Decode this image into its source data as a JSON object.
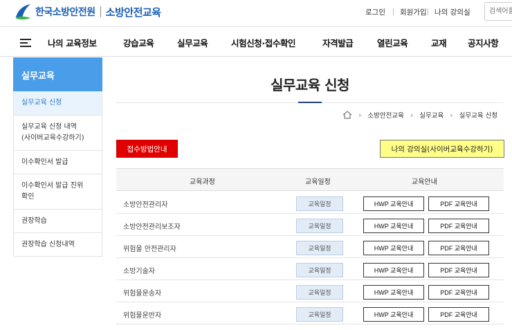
{
  "header": {
    "org_name": "한국소방안전원",
    "site_name": "소방안전교육",
    "links": [
      "로그인",
      "회원가입",
      "나의 강의실"
    ],
    "search_placeholder": "검색어를"
  },
  "nav": {
    "items": [
      "나의 교육정보",
      "강습교육",
      "실무교육",
      "시험신청·접수확인",
      "자격발급",
      "열린교육",
      "교재",
      "공지사항"
    ]
  },
  "sidebar": {
    "title": "실무교육",
    "items": [
      {
        "label": "실무교육 신청",
        "active": true
      },
      {
        "label": "실무교육 신청 내역\n(사이버교육수강하기)",
        "active": false
      },
      {
        "label": "이수확인서 발급",
        "active": false
      },
      {
        "label": "이수확인서 발급 진위\n확인",
        "active": false
      },
      {
        "label": "권장학습",
        "active": false
      },
      {
        "label": "권장학습 신청내역",
        "active": false
      }
    ]
  },
  "main": {
    "title": "실무교육 신청",
    "breadcrumb": [
      "소방안전교육",
      "실무교육",
      "실무교육 신청"
    ],
    "register_button": "접수방법안내",
    "classroom_button": "나의 강의실(사이버교육수강하기)",
    "table": {
      "headers": [
        "교육과정",
        "교육일정",
        "교육안내"
      ],
      "rows": [
        {
          "name": "소방안전관리자",
          "schedule": "교육일정",
          "hwp": "HWP 교육안내",
          "pdf": "PDF 교육안내"
        },
        {
          "name": "소방안전관리보조자",
          "schedule": "교육일정",
          "hwp": "HWP 교육안내",
          "pdf": "PDF 교육안내"
        },
        {
          "name": "위험물 안전관리자",
          "schedule": "교육일정",
          "hwp": "HWP 교육안내",
          "pdf": "PDF 교육안내"
        },
        {
          "name": "소방기술자",
          "schedule": "교육일정",
          "hwp": "HWP 교육안내",
          "pdf": "PDF 교육안내"
        },
        {
          "name": "위험물운송자",
          "schedule": "교육일정",
          "hwp": "HWP 교육안내",
          "pdf": "PDF 교육안내"
        },
        {
          "name": "위험물운반자",
          "schedule": "교육일정",
          "hwp": "HWP 교육안내",
          "pdf": "PDF 교육안내"
        }
      ]
    }
  },
  "colors": {
    "brand": "#1a5fb4",
    "sidebar_header": "#4a9de8",
    "register_button": "#e10000",
    "classroom_button": "#ffff88"
  }
}
